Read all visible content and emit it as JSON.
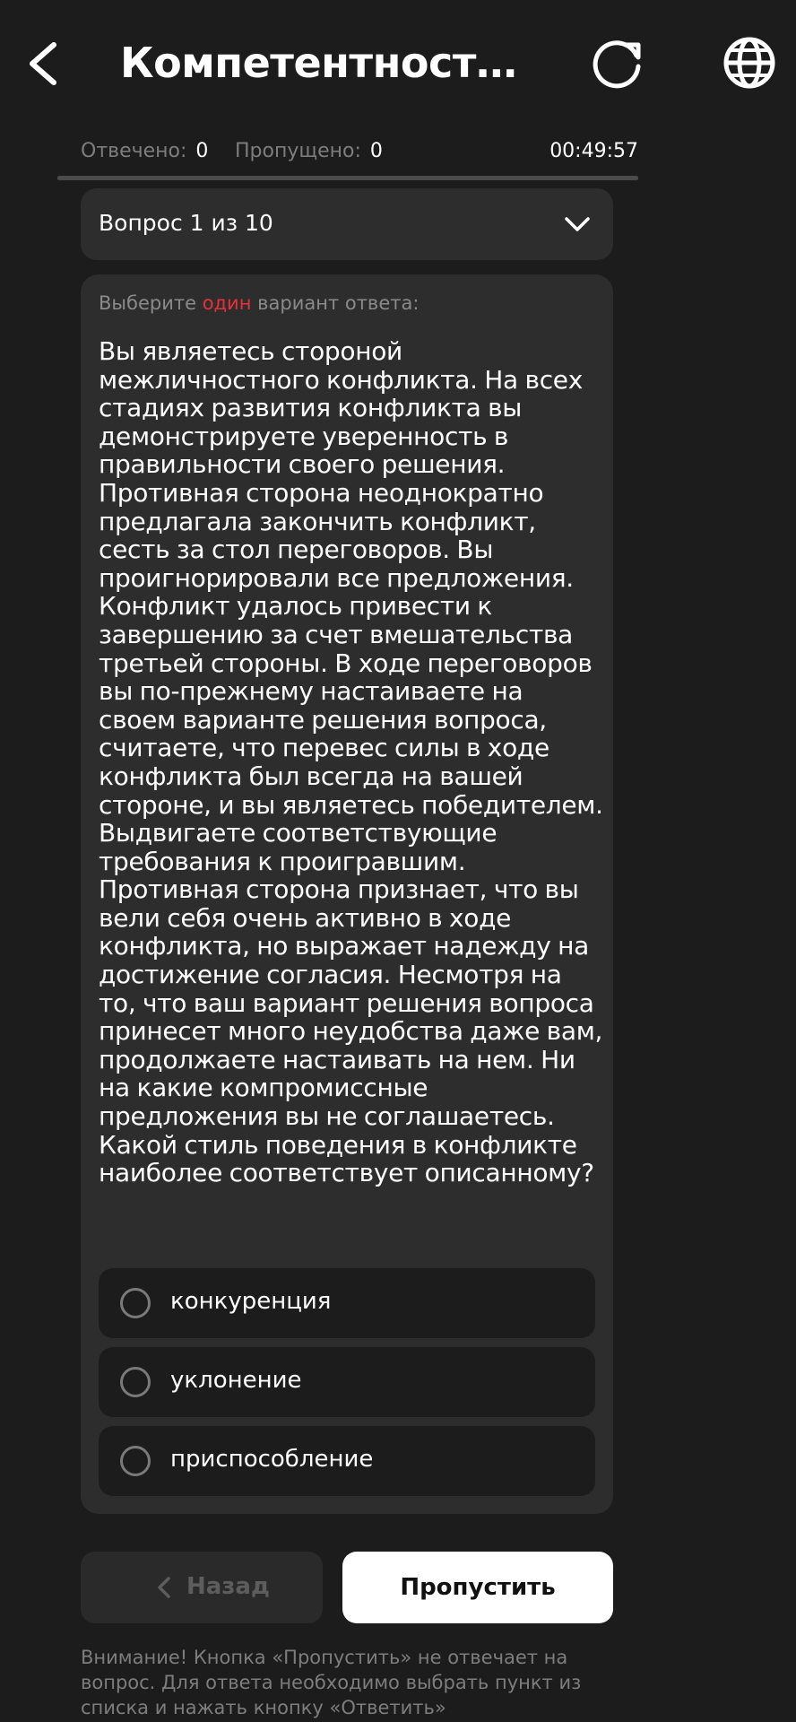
{
  "colors": {
    "background": "#1c1c1c",
    "card": "#2d2d2d",
    "accent": "#e8303a",
    "muted_text": "#7d7d7d",
    "primary_button": "#ffffff"
  },
  "header": {
    "title": "Компетентностны...",
    "back_icon": "chevron-left-icon",
    "refresh_icon": "refresh-icon",
    "language_icon": "globe-icon"
  },
  "stats": {
    "answered_label": "Отвечено:",
    "answered_count": "0",
    "skipped_label": "Пропущено:",
    "skipped_count": "0",
    "timer": "00:49:57",
    "progress_fraction": 0
  },
  "question_selector": {
    "label": "Вопрос 1 из 10",
    "icon": "chevron-down-icon"
  },
  "question": {
    "instruction_prefix": "Выберите",
    "instruction_accent": "один",
    "instruction_suffix": "вариант ответа:",
    "text": "Вы являетесь стороной межличностного конфликта. На всех стадиях развития конфликта вы демонстрируете уверенность в правильности своего решения. Противная сторона неоднократно предлагала закончить конфликт, сесть за стол переговоров. Вы проигнорировали все предложения. Конфликт удалось привести к завершению за счет вмешательства третьей стороны. В ходе переговоров вы по-прежнему настаиваете на своем варианте решения вопроса, считаете, что перевес силы в ходе конфликта был всегда на вашей стороне, и вы являетесь победителем. Выдвигаете соответствующие требования к проигравшим. Противная сторона признает, что вы вели себя очень активно в ходе конфликта, но выражает надежду на достижение согласия. Несмотря на то, что ваш вариант решения вопроса принесет много неудобства даже вам, продолжаете настаивать на нем. Ни на какие компромиссные предложения вы не соглашаетесь. Какой стиль поведения в конфликте наиболее соответствует описанному?",
    "options": [
      {
        "label": "конкуренция"
      },
      {
        "label": "уклонение"
      },
      {
        "label": "приспособление"
      }
    ]
  },
  "actions": {
    "back_label": "Назад",
    "skip_label": "Пропустить"
  },
  "notice": "Внимание! Кнопка «Пропустить» не отвечает на вопрос. Для ответа необходимо выбрать пункт из списка и нажать кнопку «Ответить»"
}
